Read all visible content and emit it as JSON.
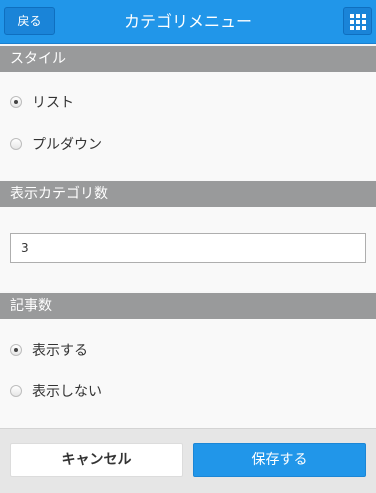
{
  "header": {
    "back_label": "戻る",
    "title": "カテゴリメニュー",
    "menu_icon": "grid-icon"
  },
  "style_section": {
    "title": "スタイル",
    "options": [
      {
        "label": "リスト",
        "checked": true
      },
      {
        "label": "プルダウン",
        "checked": false
      }
    ]
  },
  "count_section": {
    "title": "表示カテゴリ数",
    "value": "3"
  },
  "articles_section": {
    "title": "記事数",
    "options": [
      {
        "label": "表示する",
        "checked": true
      },
      {
        "label": "表示しない",
        "checked": false
      }
    ]
  },
  "footer": {
    "cancel_label": "キャンセル",
    "save_label": "保存する"
  },
  "colors": {
    "accent": "#2196e9",
    "section_header": "#999a9b"
  }
}
